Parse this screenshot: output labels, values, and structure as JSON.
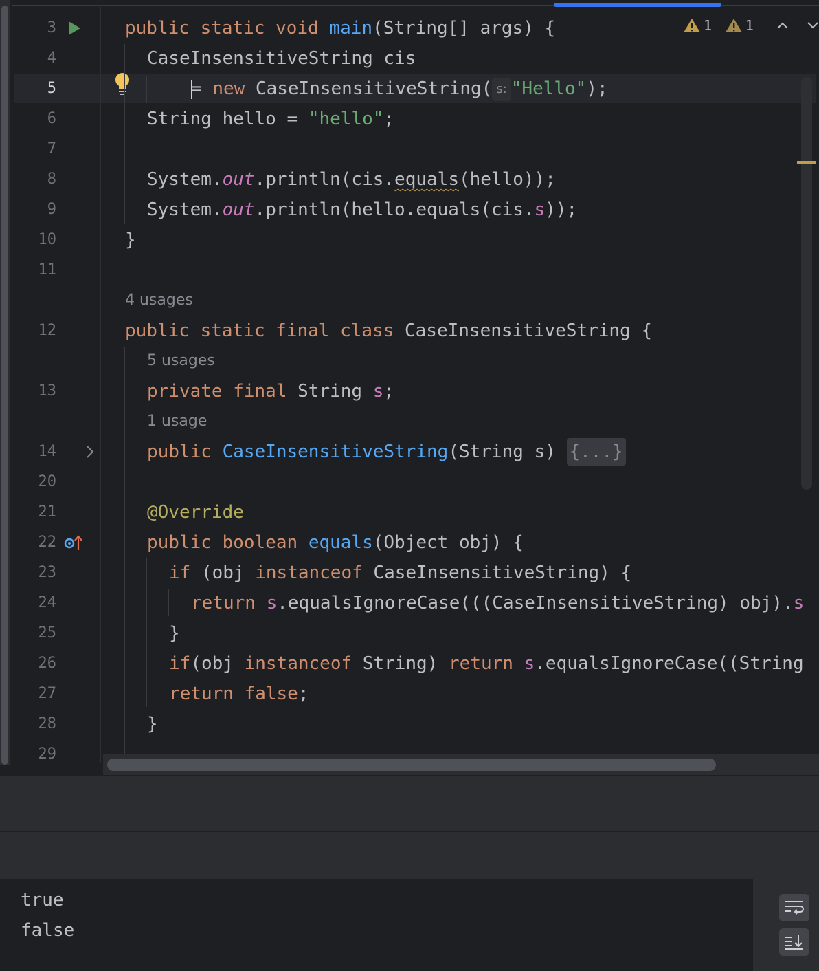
{
  "editor": {
    "inspections": {
      "warning_count_1": "1",
      "warning_count_2": "1"
    },
    "line_numbers": [
      "3",
      "4",
      "5",
      "6",
      "7",
      "8",
      "9",
      "10",
      "11",
      "12",
      "13",
      "14",
      "20",
      "21",
      "22",
      "23",
      "24",
      "25",
      "26",
      "27",
      "28",
      "29"
    ],
    "usages": {
      "class_usages": "4 usages",
      "field_usages": "5 usages",
      "ctor_usages": "1 usage"
    },
    "code": {
      "l3": {
        "kw1": "public static void ",
        "fn": "main",
        "rest": "(String[] args) {"
      },
      "l4": {
        "text": "CaseInsensitiveString cis"
      },
      "l5": {
        "eq": "= ",
        "kw": "new",
        "cls": " CaseInsensitiveString(",
        "hint": "s:",
        "str": "\"Hello\"",
        "end": ");"
      },
      "l6": {
        "pre": "String hello = ",
        "str": "\"hello\"",
        "end": ";"
      },
      "l8": {
        "a": "System.",
        "stc": "out",
        "b": ".println(cis.",
        "warn": "equals",
        "c": "(hello));"
      },
      "l9": {
        "a": "System.",
        "stc": "out",
        "b": ".println(hello.equals(cis.",
        "fld": "s",
        "c": "));"
      },
      "l10": {
        "text": "}"
      },
      "l12": {
        "kw": "public static final class ",
        "rest": "CaseInsensitiveString {"
      },
      "l13": {
        "kw": "private final ",
        "type": "String ",
        "fld": "s",
        "end": ";"
      },
      "l14": {
        "kw": "public ",
        "fn": "CaseInsensitiveString",
        "rest": "(String s) ",
        "fold": "{...}"
      },
      "l21": {
        "ann": "@Override"
      },
      "l22": {
        "kw": "public boolean ",
        "fn": "equals",
        "rest": "(Object obj) {"
      },
      "l23": {
        "kw1": "if",
        "a": " (obj ",
        "kw2": "instanceof",
        "b": " CaseInsensitiveString) {"
      },
      "l24": {
        "kw": "return ",
        "fld": "s",
        "a": ".equalsIgnoreCase(((CaseInsensitiveString) obj).",
        "fld2": "s"
      },
      "l25": {
        "text": "}"
      },
      "l26": {
        "kw1": "if",
        "a": "(obj ",
        "kw2": "instanceof",
        "b": " String) ",
        "kw3": "return ",
        "fld": "s",
        "c": ".equalsIgnoreCase((String"
      },
      "l27": {
        "kw": "return false",
        "end": ";"
      },
      "l28": {
        "text": "}"
      }
    }
  },
  "console": {
    "output": [
      "true",
      "false"
    ]
  },
  "colors": {
    "accent": "#3574f0",
    "keyword": "#cf8e6d",
    "string": "#6aab73",
    "function": "#56a8f5",
    "field": "#c77dbb",
    "warning": "#c29e4a"
  }
}
